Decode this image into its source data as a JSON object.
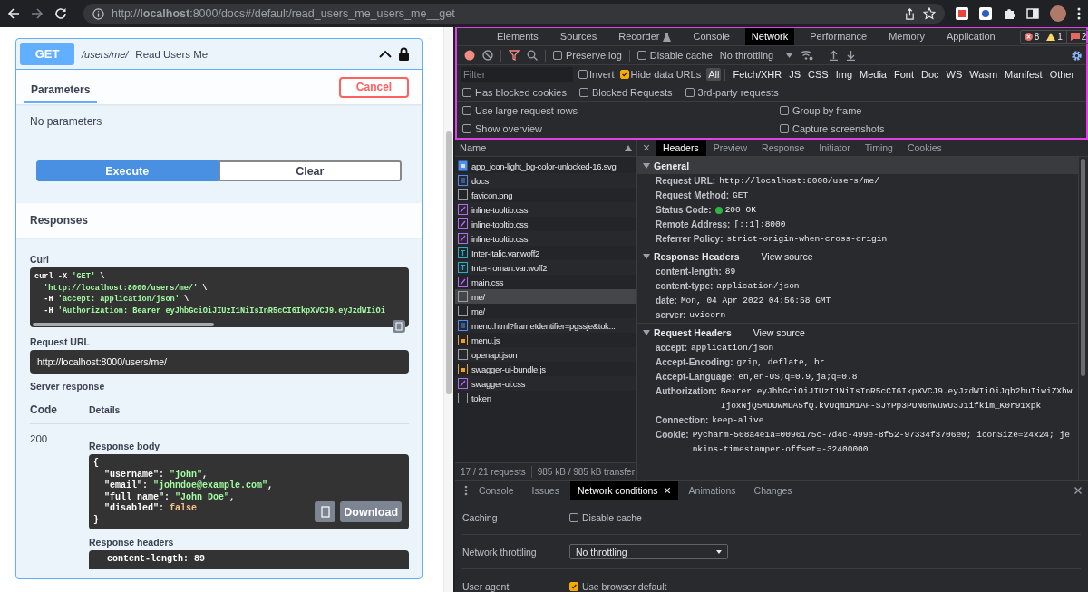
{
  "browser": {
    "url": "http://**localhost**:8000/docs#/default/read_users_me_users_me__get"
  },
  "operation": {
    "method": "GET",
    "path": "/users/me/",
    "summary": "Read Users Me",
    "expanded": true,
    "locked": true
  },
  "parameters": {
    "tab": "Parameters",
    "cancel": "Cancel",
    "message": "No parameters"
  },
  "actions": [
    {
      "label": "Execute",
      "kind": "primary"
    },
    {
      "label": "Clear",
      "kind": "secondary"
    }
  ],
  "responses": {
    "title": "Responses",
    "curl": {
      "label": "Curl",
      "lines": [
        [
          {
            "text": "curl -X ",
            "kind": "plain"
          },
          {
            "text": "'GET'",
            "kind": "string"
          },
          {
            "text": " \\",
            "kind": "plain"
          }
        ],
        [
          {
            "text": "'http://localhost:8000/users/me/'",
            "kind": "string",
            "indent": true
          },
          {
            "text": " \\",
            "kind": "plain"
          }
        ],
        [
          {
            "text": "  -H ",
            "kind": "plain"
          },
          {
            "text": "'accept: application/json'",
            "kind": "string"
          },
          {
            "text": " \\",
            "kind": "plain"
          }
        ],
        [
          {
            "text": "  -H ",
            "kind": "plain"
          },
          {
            "text": "'Authorization: Bearer eyJhbGciOiJIUzI1NiIsInR5cCI6IkpXVCJ9.eyJzdWIiOi",
            "kind": "string"
          }
        ]
      ]
    },
    "request_url": {
      "label": "Request URL",
      "value": "http://localhost:8000/users/me/"
    },
    "server_response": {
      "label": "Server response",
      "columns": [
        "Code",
        "Details"
      ],
      "code": "200",
      "body_label": "Response body",
      "body": [
        [
          {
            "text": "{",
            "kind": "plain"
          }
        ],
        [
          {
            "text": "  \"username\": ",
            "kind": "plain"
          },
          {
            "text": "\"john\"",
            "kind": "string"
          },
          {
            "text": ",",
            "kind": "plain"
          }
        ],
        [
          {
            "text": "  \"email\": ",
            "kind": "plain"
          },
          {
            "text": "\"johndoe@example.com\"",
            "kind": "string"
          },
          {
            "text": ",",
            "kind": "plain"
          }
        ],
        [
          {
            "text": "  \"full_name\": ",
            "kind": "plain"
          },
          {
            "text": "\"John Doe\"",
            "kind": "string"
          },
          {
            "text": ",",
            "kind": "plain"
          }
        ],
        [
          {
            "text": "  \"disabled\": ",
            "kind": "plain"
          },
          {
            "text": "false",
            "kind": "literal"
          }
        ],
        [
          {
            "text": "}",
            "kind": "plain"
          }
        ]
      ],
      "download": "Download",
      "headers_label": "Response headers",
      "headers": "content-length: 89"
    }
  },
  "devtools": {
    "tabs": [
      {
        "label": "Elements",
        "selected": false,
        "experimental": false
      },
      {
        "label": "Sources",
        "selected": false,
        "experimental": false
      },
      {
        "label": "Recorder",
        "selected": false,
        "experimental": true
      },
      {
        "label": "Console",
        "selected": false,
        "experimental": false
      },
      {
        "label": "Network",
        "selected": true,
        "experimental": false
      },
      {
        "label": "Performance",
        "selected": false,
        "experimental": false
      },
      {
        "label": "Memory",
        "selected": false,
        "experimental": false
      },
      {
        "label": "Application",
        "selected": false,
        "experimental": false
      }
    ],
    "counters": [
      {
        "kind": "error",
        "count": "8"
      },
      {
        "kind": "warning",
        "count": "1"
      },
      {
        "kind": "issue",
        "count": "2"
      }
    ],
    "toolbar": {
      "recording": true,
      "filter_active": true,
      "preserve_log": {
        "label": "Preserve log",
        "checked": false
      },
      "disable_cache": {
        "label": "Disable cache",
        "checked": false
      },
      "throttling": "No throttling"
    },
    "filter": {
      "placeholder": "Filter",
      "invert": {
        "label": "Invert",
        "checked": false
      },
      "hide_data_urls": {
        "label": "Hide data URLs",
        "checked": true
      },
      "types": [
        {
          "label": "All",
          "selected": true
        },
        {
          "label": "Fetch/XHR",
          "selected": false
        },
        {
          "label": "JS",
          "selected": false
        },
        {
          "label": "CSS",
          "selected": false
        },
        {
          "label": "Img",
          "selected": false
        },
        {
          "label": "Media",
          "selected": false
        },
        {
          "label": "Font",
          "selected": false
        },
        {
          "label": "Doc",
          "selected": false
        },
        {
          "label": "WS",
          "selected": false
        },
        {
          "label": "Wasm",
          "selected": false
        },
        {
          "label": "Manifest",
          "selected": false
        },
        {
          "label": "Other",
          "selected": false
        }
      ]
    },
    "blocked_options": [
      {
        "label": "Has blocked cookies",
        "checked": false
      },
      {
        "label": "Blocked Requests",
        "checked": false
      },
      {
        "label": "3rd-party requests",
        "checked": false
      }
    ],
    "settings": [
      {
        "label": "Use large request rows",
        "checked": false
      },
      {
        "label": "Group by frame",
        "checked": false
      },
      {
        "label": "Show overview",
        "checked": false
      },
      {
        "label": "Capture screenshots",
        "checked": false
      }
    ],
    "requests": {
      "column": "Name",
      "items": [
        {
          "name": "app_icon-light_bg-color-unlocked-16.svg",
          "kind": "image",
          "selected": false
        },
        {
          "name": "docs",
          "kind": "document",
          "selected": false
        },
        {
          "name": "favicon.png",
          "kind": "other",
          "selected": false
        },
        {
          "name": "inline-tooltip.css",
          "kind": "stylesheet",
          "selected": false
        },
        {
          "name": "inline-tooltip.css",
          "kind": "stylesheet",
          "selected": false
        },
        {
          "name": "inline-tooltip.css",
          "kind": "stylesheet",
          "selected": false
        },
        {
          "name": "Inter-italic.var.woff2",
          "kind": "font",
          "selected": false
        },
        {
          "name": "Inter-roman.var.woff2",
          "kind": "font",
          "selected": false
        },
        {
          "name": "main.css",
          "kind": "stylesheet",
          "selected": false
        },
        {
          "name": "me/",
          "kind": "other",
          "selected": true
        },
        {
          "name": "me/",
          "kind": "other",
          "selected": false
        },
        {
          "name": "menu.html?frameIdentifier=pgssje&tok...",
          "kind": "document",
          "selected": false
        },
        {
          "name": "menu.js",
          "kind": "script",
          "selected": false
        },
        {
          "name": "openapi.json",
          "kind": "other",
          "selected": false
        },
        {
          "name": "swagger-ui-bundle.js",
          "kind": "script",
          "selected": false
        },
        {
          "name": "swagger-ui.css",
          "kind": "stylesheet",
          "selected": false
        },
        {
          "name": "token",
          "kind": "other",
          "selected": false
        }
      ],
      "summary": [
        "17 / 21 requests",
        "985 kB / 985 kB transfer"
      ]
    },
    "details": {
      "tabs": [
        {
          "label": "Headers",
          "selected": true
        },
        {
          "label": "Preview",
          "selected": false
        },
        {
          "label": "Response",
          "selected": false
        },
        {
          "label": "Initiator",
          "selected": false
        },
        {
          "label": "Timing",
          "selected": false
        },
        {
          "label": "Cookies",
          "selected": false
        }
      ],
      "sections": [
        {
          "title": "General",
          "expanded": true,
          "rows": [
            {
              "key": "Request URL:",
              "value": "http://localhost:8000/users/me/"
            },
            {
              "key": "Request Method:",
              "value": "GET"
            },
            {
              "key": "Status Code:",
              "value": "200 OK",
              "color": "#2fb344"
            },
            {
              "key": "Remote Address:",
              "value": "[::1]:8000"
            },
            {
              "key": "Referrer Policy:",
              "value": "strict-origin-when-cross-origin"
            }
          ]
        },
        {
          "title": "Response Headers",
          "link": "View source",
          "expanded": true,
          "rows": [
            {
              "key": "content-length:",
              "value": "89"
            },
            {
              "key": "content-type:",
              "value": "application/json"
            },
            {
              "key": "date:",
              "value": "Mon, 04 Apr 2022 04:56:58 GMT"
            },
            {
              "key": "server:",
              "value": "uvicorn"
            }
          ]
        },
        {
          "title": "Request Headers",
          "link": "View source",
          "expanded": true,
          "rows": [
            {
              "key": "accept:",
              "value": "application/json"
            },
            {
              "key": "Accept-Encoding:",
              "value": "gzip, deflate, br"
            },
            {
              "key": "Accept-Language:",
              "value": "en,en-US;q=0.9,ja;q=0.8"
            },
            {
              "key": "Authorization:",
              "value": "Bearer eyJhbGciOiJIUzI1NiIsInR5cCI6IkpXVCJ9.eyJzdWIiOiJqb2huIiwiZXhwIjoxNjQ5MDUwMDA5fQ.kvUqm1M1AF-SJYPp3PUN6nwuWU3J1ifkim_K0r91xpk"
            },
            {
              "key": "Connection:",
              "value": "keep-alive"
            },
            {
              "key": "Cookie:",
              "value": "Pycharm-508a4e1a=0096175c-7d4c-499e-8f52-97334f3706e0; iconSize=24x24; jenkins-timestamper-offset=-32400000"
            }
          ]
        }
      ]
    },
    "drawer": {
      "tabs": [
        {
          "label": "Console",
          "selected": false,
          "closable": false
        },
        {
          "label": "Issues",
          "selected": false,
          "closable": false
        },
        {
          "label": "Network conditions",
          "selected": true,
          "closable": true
        },
        {
          "label": "Animations",
          "selected": false,
          "closable": false
        },
        {
          "label": "Changes",
          "selected": false,
          "closable": false
        }
      ],
      "rows": [
        {
          "label": "Caching",
          "kind": "checkbox",
          "option": "Disable cache",
          "checked": false
        },
        {
          "label": "Network throttling",
          "kind": "select",
          "value": "No throttling"
        },
        {
          "label": "User agent",
          "kind": "checkbox",
          "option": "Use browser default",
          "checked": true
        }
      ]
    }
  }
}
